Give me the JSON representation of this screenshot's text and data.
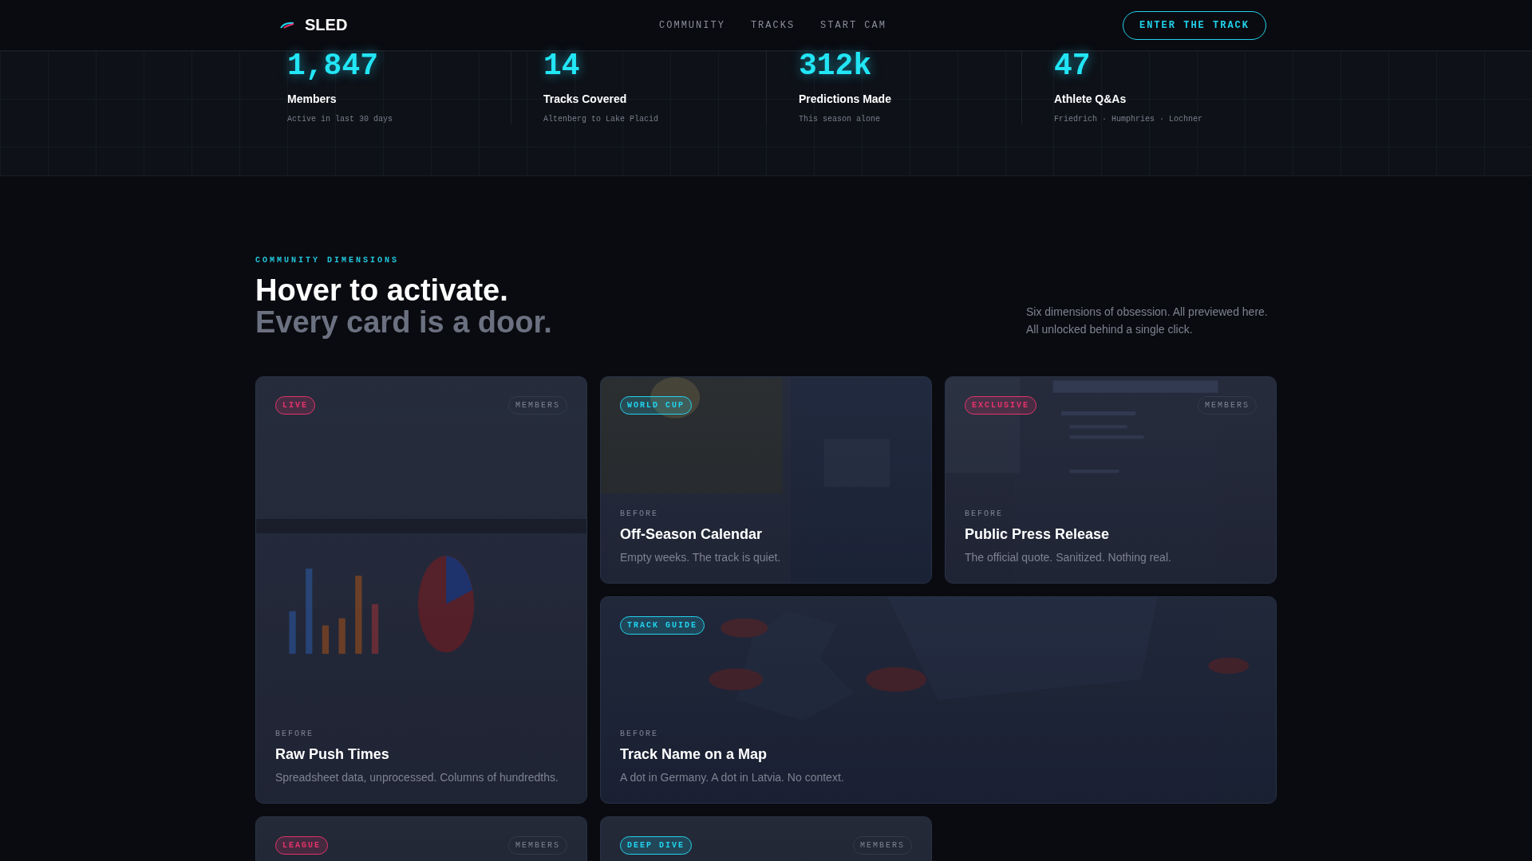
{
  "nav": {
    "brand": "SLED",
    "links": [
      "COMMUNITY",
      "TRACKS",
      "START CAM"
    ],
    "cta": "ENTER THE TRACK"
  },
  "stats": [
    {
      "value": "1,847",
      "label": "Members",
      "note": "Active in last 30 days"
    },
    {
      "value": "14",
      "label": "Tracks Covered",
      "note": "Altenberg to Lake Placid"
    },
    {
      "value": "312k",
      "label": "Predictions Made",
      "note": "This season alone"
    },
    {
      "value": "47",
      "label": "Athlete Q&As",
      "note": "Friedrich · Humphries · Lochner"
    }
  ],
  "section": {
    "eyebrow": "COMMUNITY DIMENSIONS",
    "heading": "Hover to activate.",
    "subheading": "Every card is a door.",
    "blurb_lines": [
      "Six dimensions of obsession. All previewed here.",
      "All unlocked behind a single click."
    ]
  },
  "cards": [
    {
      "kind": "tall",
      "tag": {
        "label": "LIVE",
        "color": "#e5336a"
      },
      "members": "MEMBERS",
      "before": "BEFORE",
      "title": "Raw Push Times",
      "text": "Spreadsheet data, unprocessed. Columns of hundredths."
    },
    {
      "kind": "normal",
      "tag": {
        "label": "WORLD CUP",
        "color": "#22d3ee"
      },
      "before": "BEFORE",
      "title": "Off-Season Calendar",
      "text": "Empty weeks. The track is quiet."
    },
    {
      "kind": "normal",
      "tag": {
        "label": "EXCLUSIVE",
        "color": "#e5336a"
      },
      "members": "MEMBERS",
      "before": "BEFORE",
      "title": "Public Press Release",
      "text": "The official quote. Sanitized. Nothing real."
    },
    {
      "kind": "wide",
      "tag": {
        "label": "TRACK GUIDE",
        "color": "#22d3ee"
      },
      "before": "BEFORE",
      "title": "Track Name on a Map",
      "text": "A dot in Germany. A dot in Latvia. No context."
    },
    {
      "kind": "normal",
      "tag": {
        "label": "LEAGUE",
        "color": "#e5336a"
      },
      "members": "MEMBERS"
    },
    {
      "kind": "normal",
      "tag": {
        "label": "DEEP DIVE",
        "color": "#22d3ee"
      },
      "members": "MEMBERS"
    }
  ]
}
